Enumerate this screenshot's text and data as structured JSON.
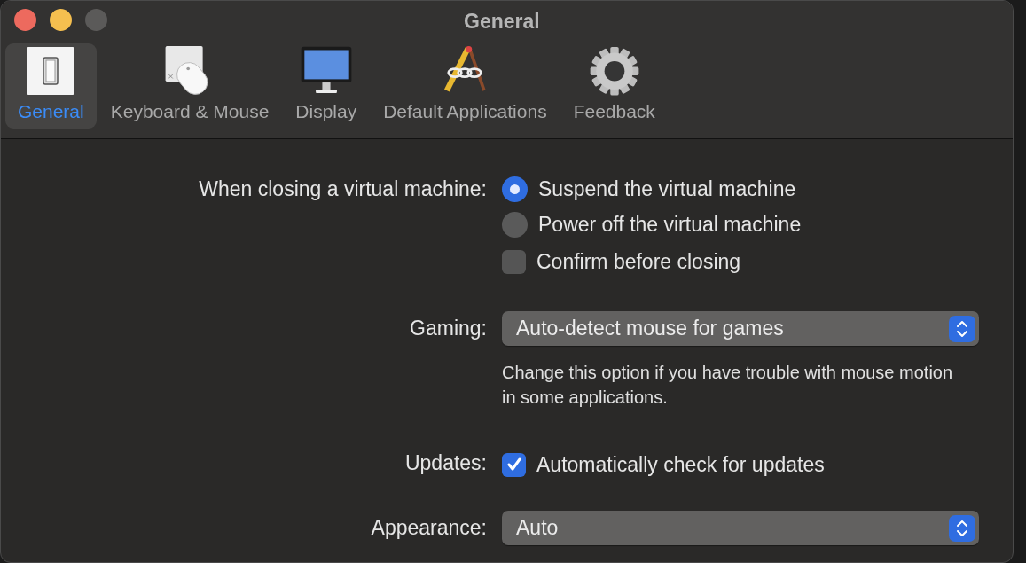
{
  "window": {
    "title": "General",
    "buttons": [
      {
        "kind": "close",
        "disabled": false
      },
      {
        "kind": "minimize",
        "disabled": false
      },
      {
        "kind": "zoom",
        "disabled": true
      }
    ]
  },
  "tabs": [
    {
      "label": "General",
      "kind": "switch",
      "selected": true
    },
    {
      "label": "Keyboard & Mouse",
      "kind": "mouse",
      "selected": false
    },
    {
      "label": "Display",
      "kind": "monitor",
      "selected": false
    },
    {
      "label": "Default Applications",
      "kind": "apps",
      "selected": false
    },
    {
      "label": "Feedback",
      "kind": "gear",
      "selected": false
    }
  ],
  "settings": [
    {
      "label": "When closing a virtual machine:",
      "controls": [
        {
          "kind": "radio",
          "text": "Suspend the virtual machine",
          "selected": true
        },
        {
          "kind": "radio",
          "text": "Power off the virtual machine",
          "selected": false
        },
        {
          "kind": "checkbox",
          "text": "Confirm before closing",
          "checked": false
        }
      ]
    },
    {
      "label": "Gaming:",
      "controls": [
        {
          "kind": "select",
          "value": "Auto-detect mouse for games"
        },
        {
          "kind": "note",
          "text": "Change this option if you have trouble with mouse motion in some applications."
        }
      ]
    },
    {
      "label": "Updates:",
      "controls": [
        {
          "kind": "checkbox",
          "text": "Automatically check for updates",
          "checked": true
        }
      ]
    },
    {
      "label": "Appearance:",
      "controls": [
        {
          "kind": "select",
          "value": "Auto"
        }
      ]
    }
  ]
}
